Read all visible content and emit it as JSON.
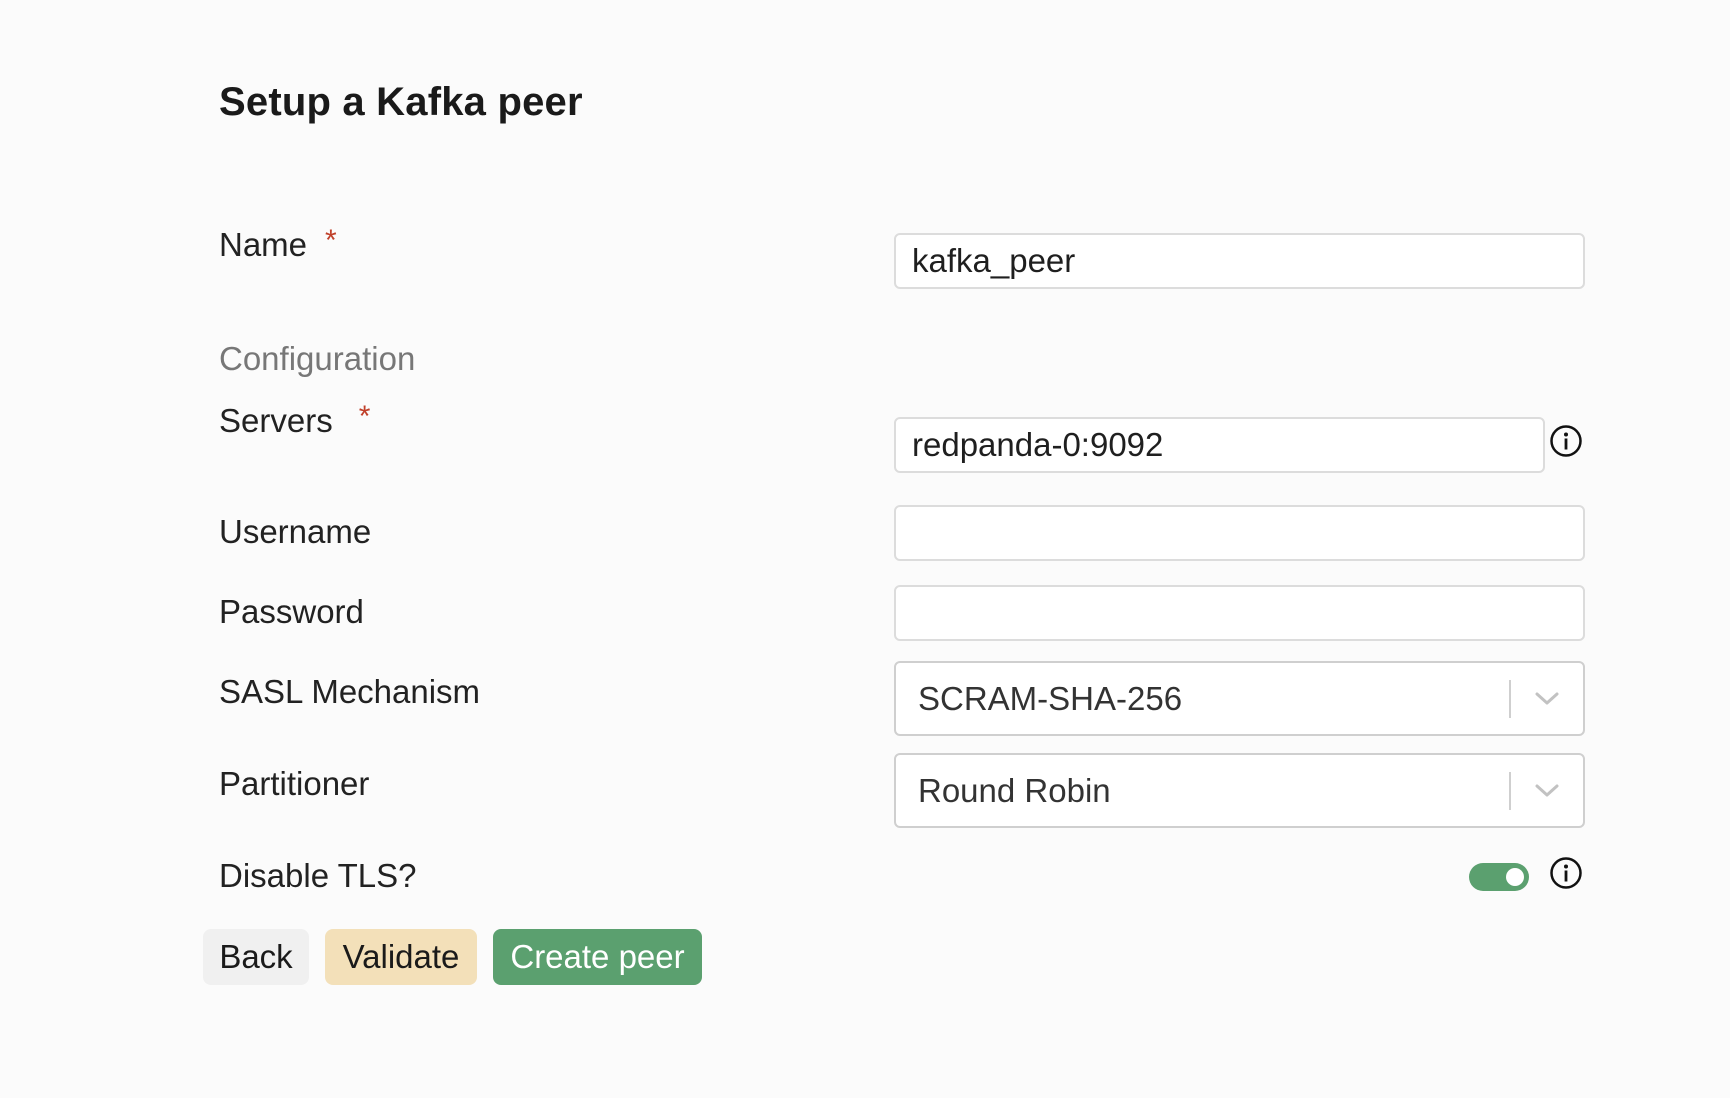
{
  "page": {
    "title": "Setup a Kafka peer"
  },
  "form": {
    "name": {
      "label": "Name",
      "required_mark": "*",
      "value": "kafka_peer"
    },
    "section_label": "Configuration",
    "servers": {
      "label": "Servers",
      "required_mark": "*",
      "value": "redpanda-0:9092"
    },
    "username": {
      "label": "Username",
      "value": ""
    },
    "password": {
      "label": "Password",
      "value": ""
    },
    "sasl_mechanism": {
      "label": "SASL Mechanism",
      "selected": "SCRAM-SHA-256"
    },
    "partitioner": {
      "label": "Partitioner",
      "selected": "Round Robin"
    },
    "disable_tls": {
      "label": "Disable TLS?",
      "enabled": true
    }
  },
  "buttons": {
    "back": "Back",
    "validate": "Validate",
    "create": "Create peer"
  },
  "colors": {
    "accent_green": "#5ba06f",
    "validate_bg": "#f3e0b9",
    "required_red": "#c0402a"
  },
  "icons": {
    "info": "info-circle-icon",
    "chevron": "chevron-down-icon"
  }
}
